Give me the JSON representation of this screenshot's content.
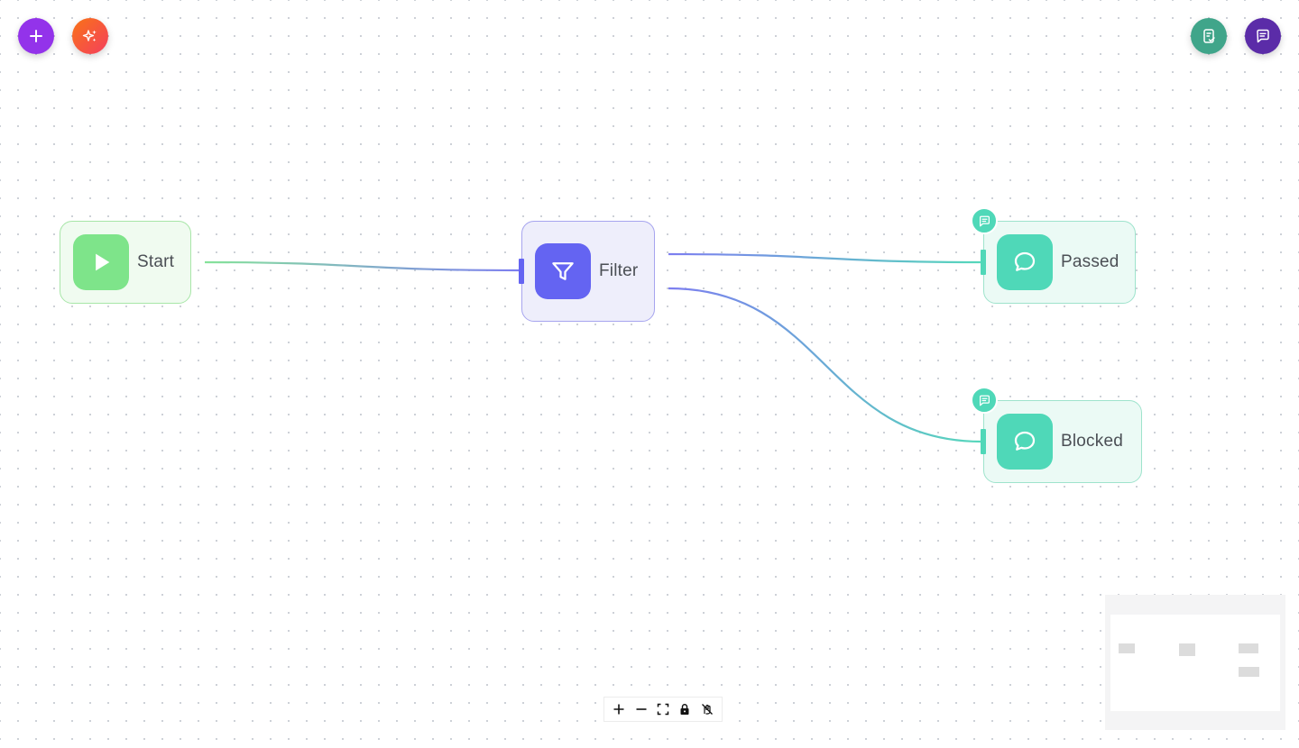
{
  "canvas": {
    "background": "#ffffff",
    "dot_color": "#c9cdd4"
  },
  "toolbar_left": [
    {
      "name": "add-node",
      "icon": "plus-icon",
      "color": "#9333ea"
    },
    {
      "name": "ai-assist",
      "icon": "sparkles-icon",
      "color": "#f97316"
    }
  ],
  "toolbar_right": [
    {
      "name": "tasks",
      "icon": "clipboard-check-icon",
      "color": "#40a58a"
    },
    {
      "name": "chat",
      "icon": "message-square-icon",
      "color": "#5b2ca8"
    }
  ],
  "nodes": {
    "start": {
      "label": "Start",
      "icon": "play-icon",
      "color": "#7ee48a"
    },
    "filter": {
      "label": "Filter",
      "icon": "funnel-icon",
      "color": "#6464f2"
    },
    "passed": {
      "label": "Passed",
      "icon": "message-circle-icon",
      "color": "#4fd8b8"
    },
    "blocked": {
      "label": "Blocked",
      "icon": "message-circle-icon",
      "color": "#4fd8b8"
    }
  },
  "edges": [
    {
      "from": "start",
      "to": "filter"
    },
    {
      "from": "filter",
      "to": "passed"
    },
    {
      "from": "filter",
      "to": "blocked"
    }
  ],
  "controls": [
    {
      "name": "zoom-in",
      "icon": "plus-icon"
    },
    {
      "name": "zoom-out",
      "icon": "minus-icon"
    },
    {
      "name": "fit-view",
      "icon": "fullscreen-icon"
    },
    {
      "name": "lock",
      "icon": "lock-icon"
    },
    {
      "name": "interaction-toggle",
      "icon": "hand-off-icon"
    }
  ],
  "minimap": {
    "node_count": 4
  }
}
